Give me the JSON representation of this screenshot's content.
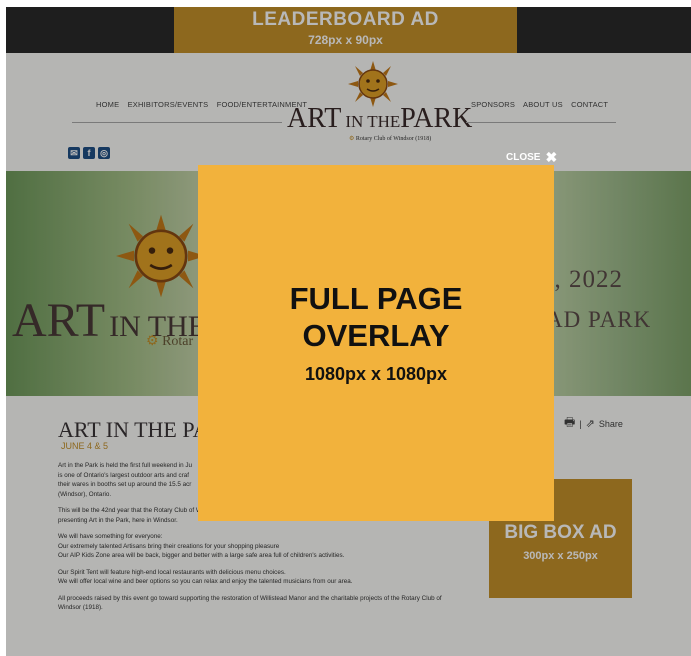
{
  "leaderboard": {
    "title": "LEADERBOARD AD",
    "size": "728px x 90px"
  },
  "nav": {
    "left": [
      "HOME",
      "EXHIBITORS/EVENTS",
      "FOOD/ENTERTAINMENT"
    ],
    "right": [
      "SPONSORS",
      "ABOUT US",
      "CONTACT"
    ]
  },
  "logo": {
    "art": "ART",
    "in_the": "IN THE",
    "park": "PARK",
    "sub": "Rotary Club of Windsor (1918)"
  },
  "social": [
    "email-icon",
    "facebook-icon",
    "instagram-icon"
  ],
  "hero": {
    "art": "ART",
    "in_the": "IN THE",
    "rotary": "Rotar",
    "date": "5, 2022",
    "park": "AD PARK"
  },
  "page": {
    "title": "ART IN THE PAR",
    "date": "JUNE 4 & 5",
    "paragraphs": [
      [
        "Art in the Park is held the first full weekend in Ju",
        "is one of Ontario's largest outdoor arts and craf",
        "their wares in booths set up around the 15.5 acr",
        "(Windsor), Ontario."
      ],
      [
        "This will be the 42nd year that the Rotary Club of Windsor (1918), acting as the agent for the Rotary Club of Windsor Foundation Fund, will be",
        "presenting Art in the Park, here in Windsor."
      ],
      [
        "We will have something for everyone:",
        "Our extremely talented Artisans bring their creations for your shopping pleasure",
        "Our AIP Kids Zone area will be back, bigger and better with a large safe area full of children's activities."
      ],
      [
        "Our Spirit Tent will feature high-end local restaurants with delicious menu choices.",
        "We will offer local wine and beer options so you can relax and enjoy the talented musicians from our area."
      ],
      [
        "All proceeds raised by this event go toward supporting the restoration of Willistead Manor and the charitable projects of the Rotary Club of",
        "Windsor (1918)."
      ]
    ]
  },
  "share": {
    "separator": "|",
    "label": "Share"
  },
  "bigbox": {
    "title": "BIG BOX AD",
    "size": "300px x 250px"
  },
  "overlay": {
    "close_label": "CLOSE",
    "title_line1": "FULL PAGE",
    "title_line2": "OVERLAY",
    "size": "1080px x 1080px"
  },
  "colors": {
    "ad_gold": "#c4902a",
    "overlay_orange": "#f2b23c",
    "topbar": "#2a2a2a"
  }
}
